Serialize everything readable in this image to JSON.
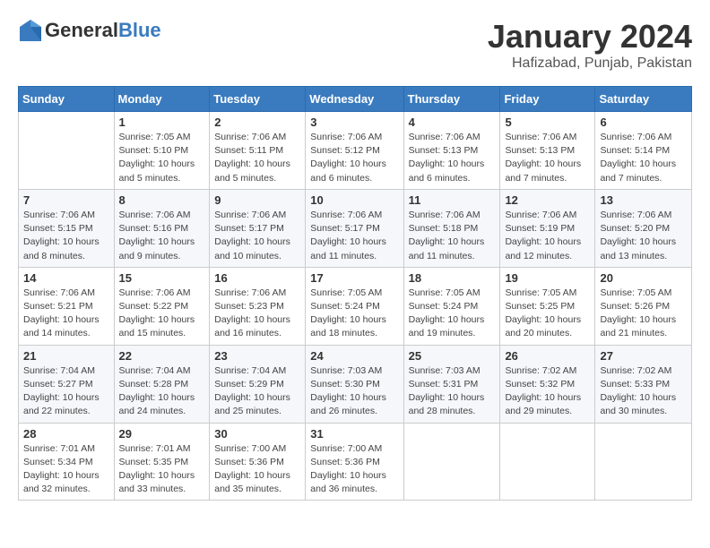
{
  "header": {
    "logo_general": "General",
    "logo_blue": "Blue",
    "month_title": "January 2024",
    "location": "Hafizabad, Punjab, Pakistan"
  },
  "columns": [
    "Sunday",
    "Monday",
    "Tuesday",
    "Wednesday",
    "Thursday",
    "Friday",
    "Saturday"
  ],
  "weeks": [
    [
      {
        "day": "",
        "info": ""
      },
      {
        "day": "1",
        "info": "Sunrise: 7:05 AM\nSunset: 5:10 PM\nDaylight: 10 hours\nand 5 minutes."
      },
      {
        "day": "2",
        "info": "Sunrise: 7:06 AM\nSunset: 5:11 PM\nDaylight: 10 hours\nand 5 minutes."
      },
      {
        "day": "3",
        "info": "Sunrise: 7:06 AM\nSunset: 5:12 PM\nDaylight: 10 hours\nand 6 minutes."
      },
      {
        "day": "4",
        "info": "Sunrise: 7:06 AM\nSunset: 5:13 PM\nDaylight: 10 hours\nand 6 minutes."
      },
      {
        "day": "5",
        "info": "Sunrise: 7:06 AM\nSunset: 5:13 PM\nDaylight: 10 hours\nand 7 minutes."
      },
      {
        "day": "6",
        "info": "Sunrise: 7:06 AM\nSunset: 5:14 PM\nDaylight: 10 hours\nand 7 minutes."
      }
    ],
    [
      {
        "day": "7",
        "info": "Sunrise: 7:06 AM\nSunset: 5:15 PM\nDaylight: 10 hours\nand 8 minutes."
      },
      {
        "day": "8",
        "info": "Sunrise: 7:06 AM\nSunset: 5:16 PM\nDaylight: 10 hours\nand 9 minutes."
      },
      {
        "day": "9",
        "info": "Sunrise: 7:06 AM\nSunset: 5:17 PM\nDaylight: 10 hours\nand 10 minutes."
      },
      {
        "day": "10",
        "info": "Sunrise: 7:06 AM\nSunset: 5:17 PM\nDaylight: 10 hours\nand 11 minutes."
      },
      {
        "day": "11",
        "info": "Sunrise: 7:06 AM\nSunset: 5:18 PM\nDaylight: 10 hours\nand 11 minutes."
      },
      {
        "day": "12",
        "info": "Sunrise: 7:06 AM\nSunset: 5:19 PM\nDaylight: 10 hours\nand 12 minutes."
      },
      {
        "day": "13",
        "info": "Sunrise: 7:06 AM\nSunset: 5:20 PM\nDaylight: 10 hours\nand 13 minutes."
      }
    ],
    [
      {
        "day": "14",
        "info": "Sunrise: 7:06 AM\nSunset: 5:21 PM\nDaylight: 10 hours\nand 14 minutes."
      },
      {
        "day": "15",
        "info": "Sunrise: 7:06 AM\nSunset: 5:22 PM\nDaylight: 10 hours\nand 15 minutes."
      },
      {
        "day": "16",
        "info": "Sunrise: 7:06 AM\nSunset: 5:23 PM\nDaylight: 10 hours\nand 16 minutes."
      },
      {
        "day": "17",
        "info": "Sunrise: 7:05 AM\nSunset: 5:24 PM\nDaylight: 10 hours\nand 18 minutes."
      },
      {
        "day": "18",
        "info": "Sunrise: 7:05 AM\nSunset: 5:24 PM\nDaylight: 10 hours\nand 19 minutes."
      },
      {
        "day": "19",
        "info": "Sunrise: 7:05 AM\nSunset: 5:25 PM\nDaylight: 10 hours\nand 20 minutes."
      },
      {
        "day": "20",
        "info": "Sunrise: 7:05 AM\nSunset: 5:26 PM\nDaylight: 10 hours\nand 21 minutes."
      }
    ],
    [
      {
        "day": "21",
        "info": "Sunrise: 7:04 AM\nSunset: 5:27 PM\nDaylight: 10 hours\nand 22 minutes."
      },
      {
        "day": "22",
        "info": "Sunrise: 7:04 AM\nSunset: 5:28 PM\nDaylight: 10 hours\nand 24 minutes."
      },
      {
        "day": "23",
        "info": "Sunrise: 7:04 AM\nSunset: 5:29 PM\nDaylight: 10 hours\nand 25 minutes."
      },
      {
        "day": "24",
        "info": "Sunrise: 7:03 AM\nSunset: 5:30 PM\nDaylight: 10 hours\nand 26 minutes."
      },
      {
        "day": "25",
        "info": "Sunrise: 7:03 AM\nSunset: 5:31 PM\nDaylight: 10 hours\nand 28 minutes."
      },
      {
        "day": "26",
        "info": "Sunrise: 7:02 AM\nSunset: 5:32 PM\nDaylight: 10 hours\nand 29 minutes."
      },
      {
        "day": "27",
        "info": "Sunrise: 7:02 AM\nSunset: 5:33 PM\nDaylight: 10 hours\nand 30 minutes."
      }
    ],
    [
      {
        "day": "28",
        "info": "Sunrise: 7:01 AM\nSunset: 5:34 PM\nDaylight: 10 hours\nand 32 minutes."
      },
      {
        "day": "29",
        "info": "Sunrise: 7:01 AM\nSunset: 5:35 PM\nDaylight: 10 hours\nand 33 minutes."
      },
      {
        "day": "30",
        "info": "Sunrise: 7:00 AM\nSunset: 5:36 PM\nDaylight: 10 hours\nand 35 minutes."
      },
      {
        "day": "31",
        "info": "Sunrise: 7:00 AM\nSunset: 5:36 PM\nDaylight: 10 hours\nand 36 minutes."
      },
      {
        "day": "",
        "info": ""
      },
      {
        "day": "",
        "info": ""
      },
      {
        "day": "",
        "info": ""
      }
    ]
  ]
}
